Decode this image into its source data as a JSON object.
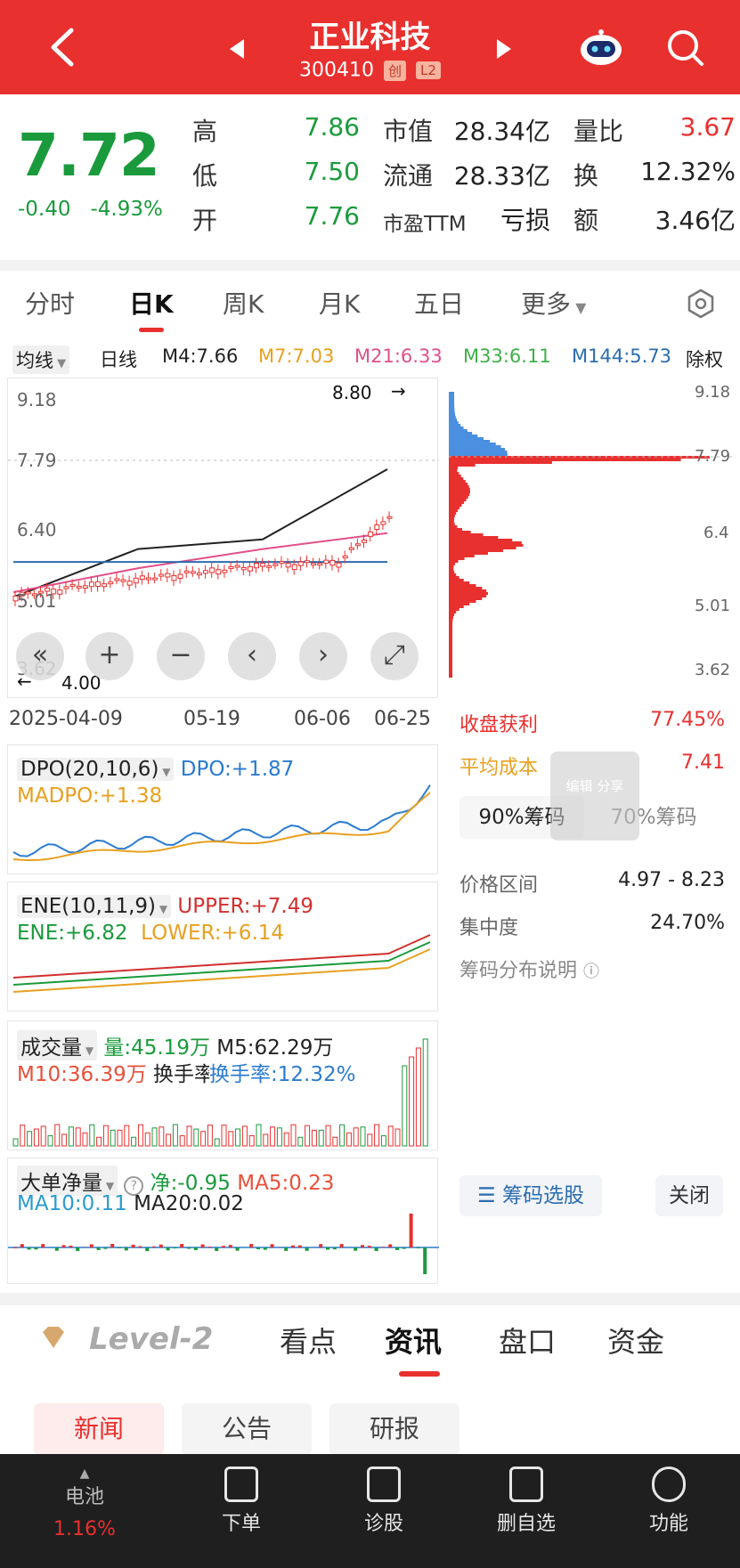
{
  "header": {
    "title": "正业科技",
    "code": "300410",
    "tag_board": "创",
    "tag_level": "L2"
  },
  "quote": {
    "price": "7.72",
    "change": "-0.40",
    "change_pct": "-4.93%",
    "high_label": "高",
    "high": "7.86",
    "low_label": "低",
    "low": "7.50",
    "open_label": "开",
    "open": "7.76",
    "mcap_label": "市值",
    "mcap": "28.34亿",
    "float_label": "流通",
    "float": "28.33亿",
    "pe_label": "市盈TTM",
    "pe": "亏损",
    "vr_label": "量比",
    "vr": "3.67",
    "turnover_label": "换",
    "turnover": "12.32%",
    "amount_label": "额",
    "amount": "3.46亿"
  },
  "period_tabs": [
    "分时",
    "日K",
    "周K",
    "月K",
    "五日",
    "更多"
  ],
  "ma_row": {
    "toggle": "均线",
    "kind": "日线",
    "m4": "M4:7.66",
    "m7": "M7:7.03",
    "m21": "M21:6.33",
    "m33": "M33:6.11",
    "m144": "M144:5.73",
    "adjust": "除权"
  },
  "kline": {
    "y_labels": [
      "9.18",
      "7.79",
      "6.40",
      "5.01",
      "3.62"
    ],
    "max_marker": "8.80",
    "min_marker": "4.00",
    "dates": [
      "2025-04-09",
      "05-19",
      "06-06",
      "06-25"
    ],
    "controls": [
      "«",
      "+",
      "−",
      "‹",
      "›",
      "⤢"
    ]
  },
  "chart_data": {
    "type": "line",
    "x": [
      "2025-04-09",
      "05-19",
      "06-06",
      "06-25"
    ],
    "series": [
      {
        "name": "M4",
        "values": [
          5.0,
          6.0,
          6.2,
          7.66
        ]
      },
      {
        "name": "M21",
        "values": [
          5.1,
          5.6,
          6.0,
          6.33
        ]
      },
      {
        "name": "M144",
        "values": [
          5.73,
          5.73,
          5.73,
          5.73
        ]
      }
    ],
    "ylim": [
      3.62,
      9.18
    ]
  },
  "chips": {
    "y_labels": [
      "9.18",
      "7.79",
      "6.4",
      "5.01",
      "3.62"
    ],
    "profit_label": "收盘获利",
    "profit": "77.45%",
    "cost_label": "平均成本",
    "cost": "7.41",
    "tab90": "90%筹码",
    "tab70": "70%筹码",
    "range_label": "价格区间",
    "range": "4.97 - 8.23",
    "conc_label": "集中度",
    "conc": "24.70%",
    "explain": "筹码分布说明",
    "btn_select": "筹码选股",
    "btn_close": "关闭",
    "float_btn": "编辑 分享"
  },
  "dpo": {
    "name": "DPO(20,10,6)",
    "dpo": "DPO:+1.87",
    "madpo": "MADPO:+1.38"
  },
  "ene": {
    "name": "ENE(10,11,9)",
    "upper": "UPPER:+7.49",
    "ene": "ENE:+6.82",
    "lower": "LOWER:+6.14"
  },
  "vol": {
    "name": "成交量",
    "vol": "量:45.19万",
    "m5": "M5:62.29万",
    "m10": "M10:36.39万",
    "turn": "换手率:12.32%"
  },
  "net": {
    "name": "大单净量",
    "net": "净:-0.95",
    "ma5": "MA5:0.23",
    "ma10": "MA10:0.11",
    "ma20": "MA20:0.02"
  },
  "bottom_tabs": [
    "Level-2",
    "看点",
    "资讯",
    "盘口",
    "资金"
  ],
  "sub_tabs": [
    "新闻",
    "公告",
    "研报"
  ],
  "bottom_bar": [
    {
      "label": "电池",
      "sub": "1.16%"
    },
    {
      "label": "下单"
    },
    {
      "label": "诊股"
    },
    {
      "label": "删自选"
    },
    {
      "label": "功能"
    }
  ]
}
